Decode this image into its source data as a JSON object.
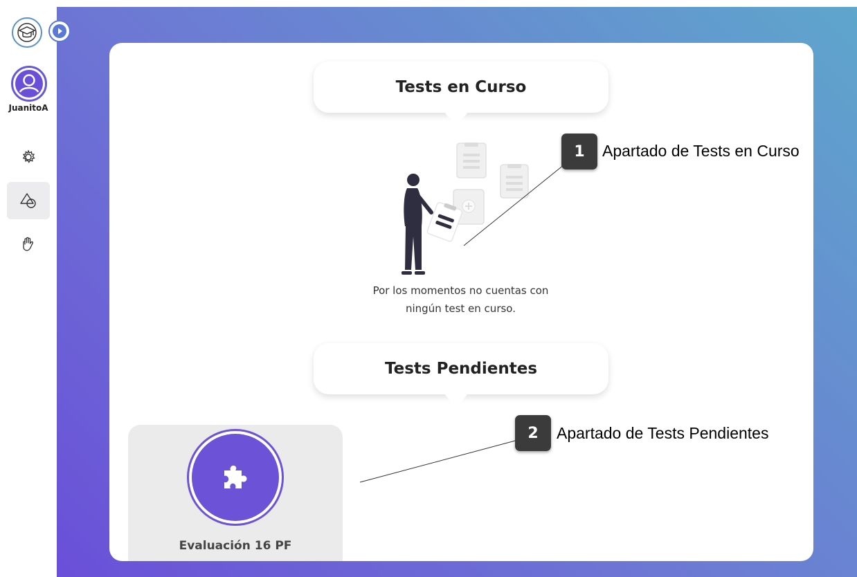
{
  "sidebar": {
    "username": "JuanitoA",
    "items": [
      {
        "icon": "gear-icon"
      },
      {
        "icon": "shapes-icon",
        "active": true
      },
      {
        "icon": "hand-icon"
      }
    ]
  },
  "main": {
    "in_progress": {
      "title": "Tests en Curso",
      "empty_message_line1": "Por los momentos no cuentas con",
      "empty_message_line2": "ningún test en curso."
    },
    "pending": {
      "title": "Tests Pendientes",
      "tests": [
        {
          "name": "Evaluación 16 PF",
          "icon": "puzzle-icon"
        }
      ]
    }
  },
  "annotations": [
    {
      "number": "1",
      "label": "Apartado de Tests en Curso"
    },
    {
      "number": "2",
      "label": "Apartado de Tests Pendientes"
    }
  ],
  "colors": {
    "accent": "#6b52d6",
    "gradient_start": "#6a4fd8",
    "gradient_end": "#5ea6cc",
    "callout_bg": "#3b3b3b"
  }
}
